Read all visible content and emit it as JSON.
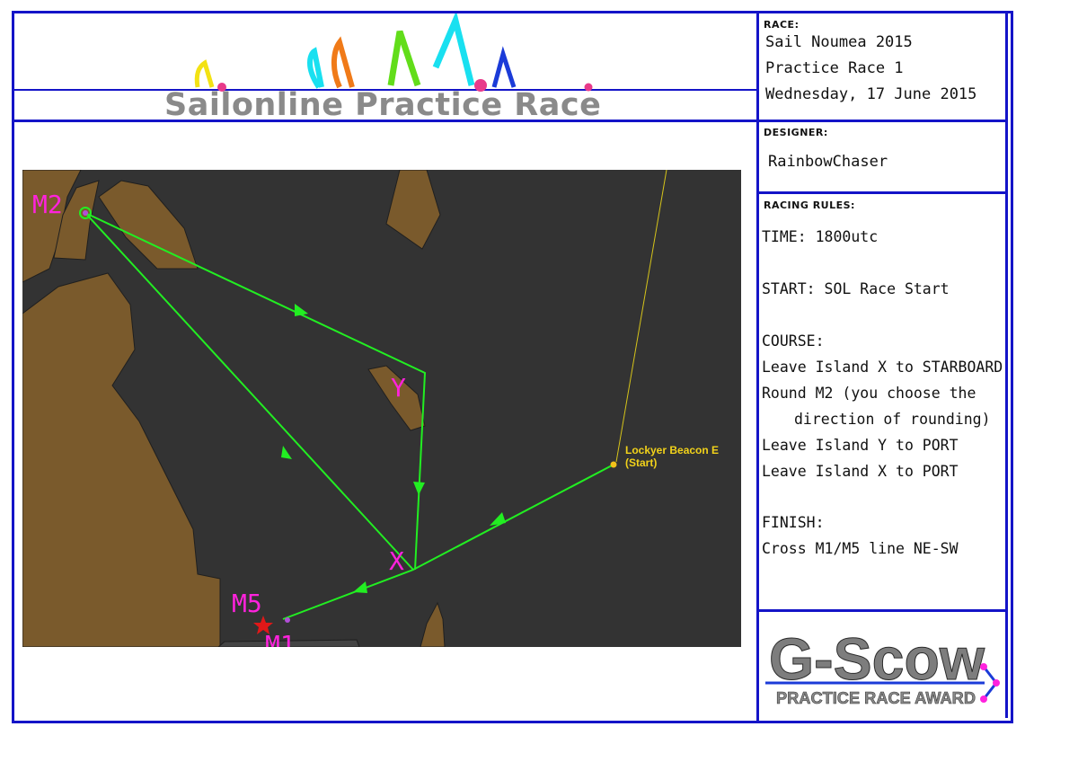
{
  "banner": {
    "title": "Sailonline Practice Race"
  },
  "race": {
    "label": "RACE:",
    "lines": [
      "Sail Noumea 2015",
      "Practice Race 1",
      "Wednesday, 17 June 2015"
    ]
  },
  "designer": {
    "label": "DESIGNER:",
    "name": "RainbowChaser"
  },
  "rules": {
    "label": "RACING RULES:",
    "time": "TIME: 1800utc",
    "start": "START:  SOL Race Start",
    "course_label": "COURSE:",
    "course": [
      "Leave Island X to STARBOARD",
      "Round M2 (you choose the",
      "direction of rounding)",
      "Leave Island Y to PORT",
      "Leave Island X to PORT"
    ],
    "finish_label": "FINISH:",
    "finish": "Cross M1/M5 line NE-SW"
  },
  "map": {
    "marks": {
      "m2": "M2",
      "m5": "M5",
      "m1": "M1",
      "x": "X",
      "y": "Y"
    },
    "start_label_1": "Lockyer Beacon E",
    "start_label_2": "(Start)",
    "colors": {
      "water": "#333333",
      "land": "#7a5a2c",
      "route": "#22ee22",
      "mark_label": "#ff22dd",
      "start": "#f2d21a"
    }
  },
  "award": {
    "title": "G-Scow",
    "subtitle": "PRACTICE RACE AWARD"
  }
}
